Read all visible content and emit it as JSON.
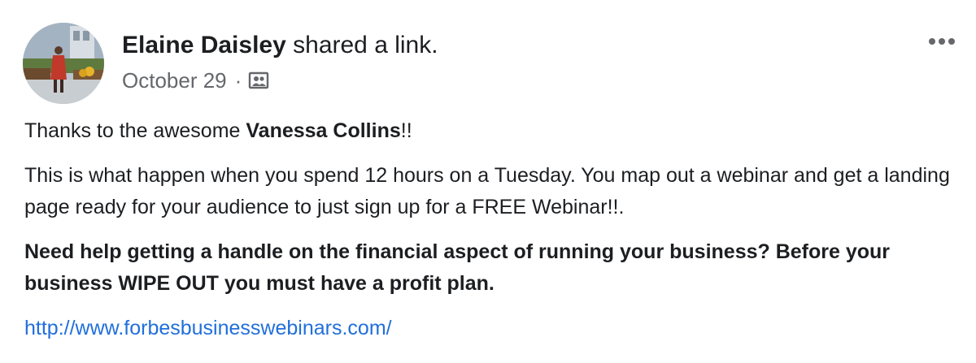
{
  "post": {
    "author": "Elaine Daisley",
    "action": "shared a link.",
    "date": "October 29",
    "separator": "·",
    "privacy_icon": "group-privacy-icon",
    "more_icon": "more-options-icon",
    "line1_prefix": "Thanks to the awesome ",
    "line1_mention": "Vanessa Collins",
    "line1_suffix": "!!",
    "para2": "This is what happen when you spend 12 hours on a Tuesday. You map out a webinar and get a landing page ready for your audience to just sign up for a FREE Webinar!!.",
    "para3": "Need help getting a handle on the financial aspect of running your business? Before your business WIPE OUT you must have a profit plan.",
    "link": "http://www.forbesbusinesswebinars.com/"
  },
  "colors": {
    "text": "#1c1e21",
    "secondary": "#65676b",
    "link": "#216fdb"
  }
}
